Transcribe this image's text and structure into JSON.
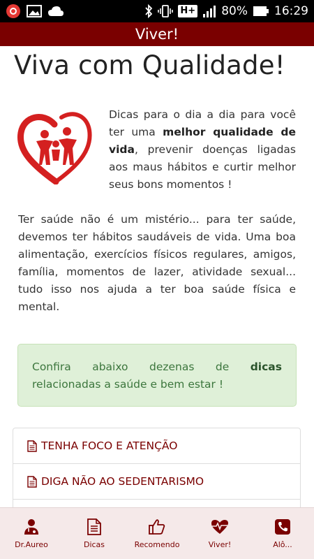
{
  "status_bar": {
    "battery": "80%",
    "time": "16:29",
    "network": "H+",
    "icons": [
      "recorder-icon",
      "image-icon",
      "cloud-icon",
      "bluetooth-icon",
      "vibrate-icon",
      "signal-icon",
      "battery-icon"
    ]
  },
  "app_bar": {
    "title": "Viver!"
  },
  "colors": {
    "brand": "#7a0000",
    "alert_bg": "#dff0d8",
    "alert_text": "#3c763d",
    "nav_bg": "#f5e9e9"
  },
  "main": {
    "title": "Viva com Qualidade!",
    "intro": {
      "part1": "Dicas para o dia a dia para você ter uma ",
      "bold": "melhor qualidade de vida",
      "part2": ", prevenir doenças ligadas aos maus hábitos e curtir melhor seus bons momentos !"
    },
    "body": "Ter saúde não é um mistério... para ter saúde, devemos ter hábitos saudáveis de vida. Uma boa alimentação, exercícios físicos regulares, amigos, família, momentos de lazer, atividade sexual... tudo isso nos ajuda a ter boa saúde física e mental.",
    "alert": {
      "part1": "Confira abaixo dezenas de ",
      "bold": "dicas",
      "part2": " relacionadas a saúde e bem estar !"
    },
    "list": [
      {
        "label": "TENHA FOCO E ATENÇÃO"
      },
      {
        "label": "DIGA NÃO AO SEDENTARISMO"
      },
      {
        "label": ""
      }
    ]
  },
  "bottom_nav": [
    {
      "label": "Dr.Aureo",
      "icon": "doctor-icon"
    },
    {
      "label": "Dicas",
      "icon": "document-icon"
    },
    {
      "label": "Recomendo",
      "icon": "thumbs-up-icon"
    },
    {
      "label": "Viver!",
      "icon": "heartbeat-icon"
    },
    {
      "label": "Alô...",
      "icon": "phone-icon"
    }
  ]
}
